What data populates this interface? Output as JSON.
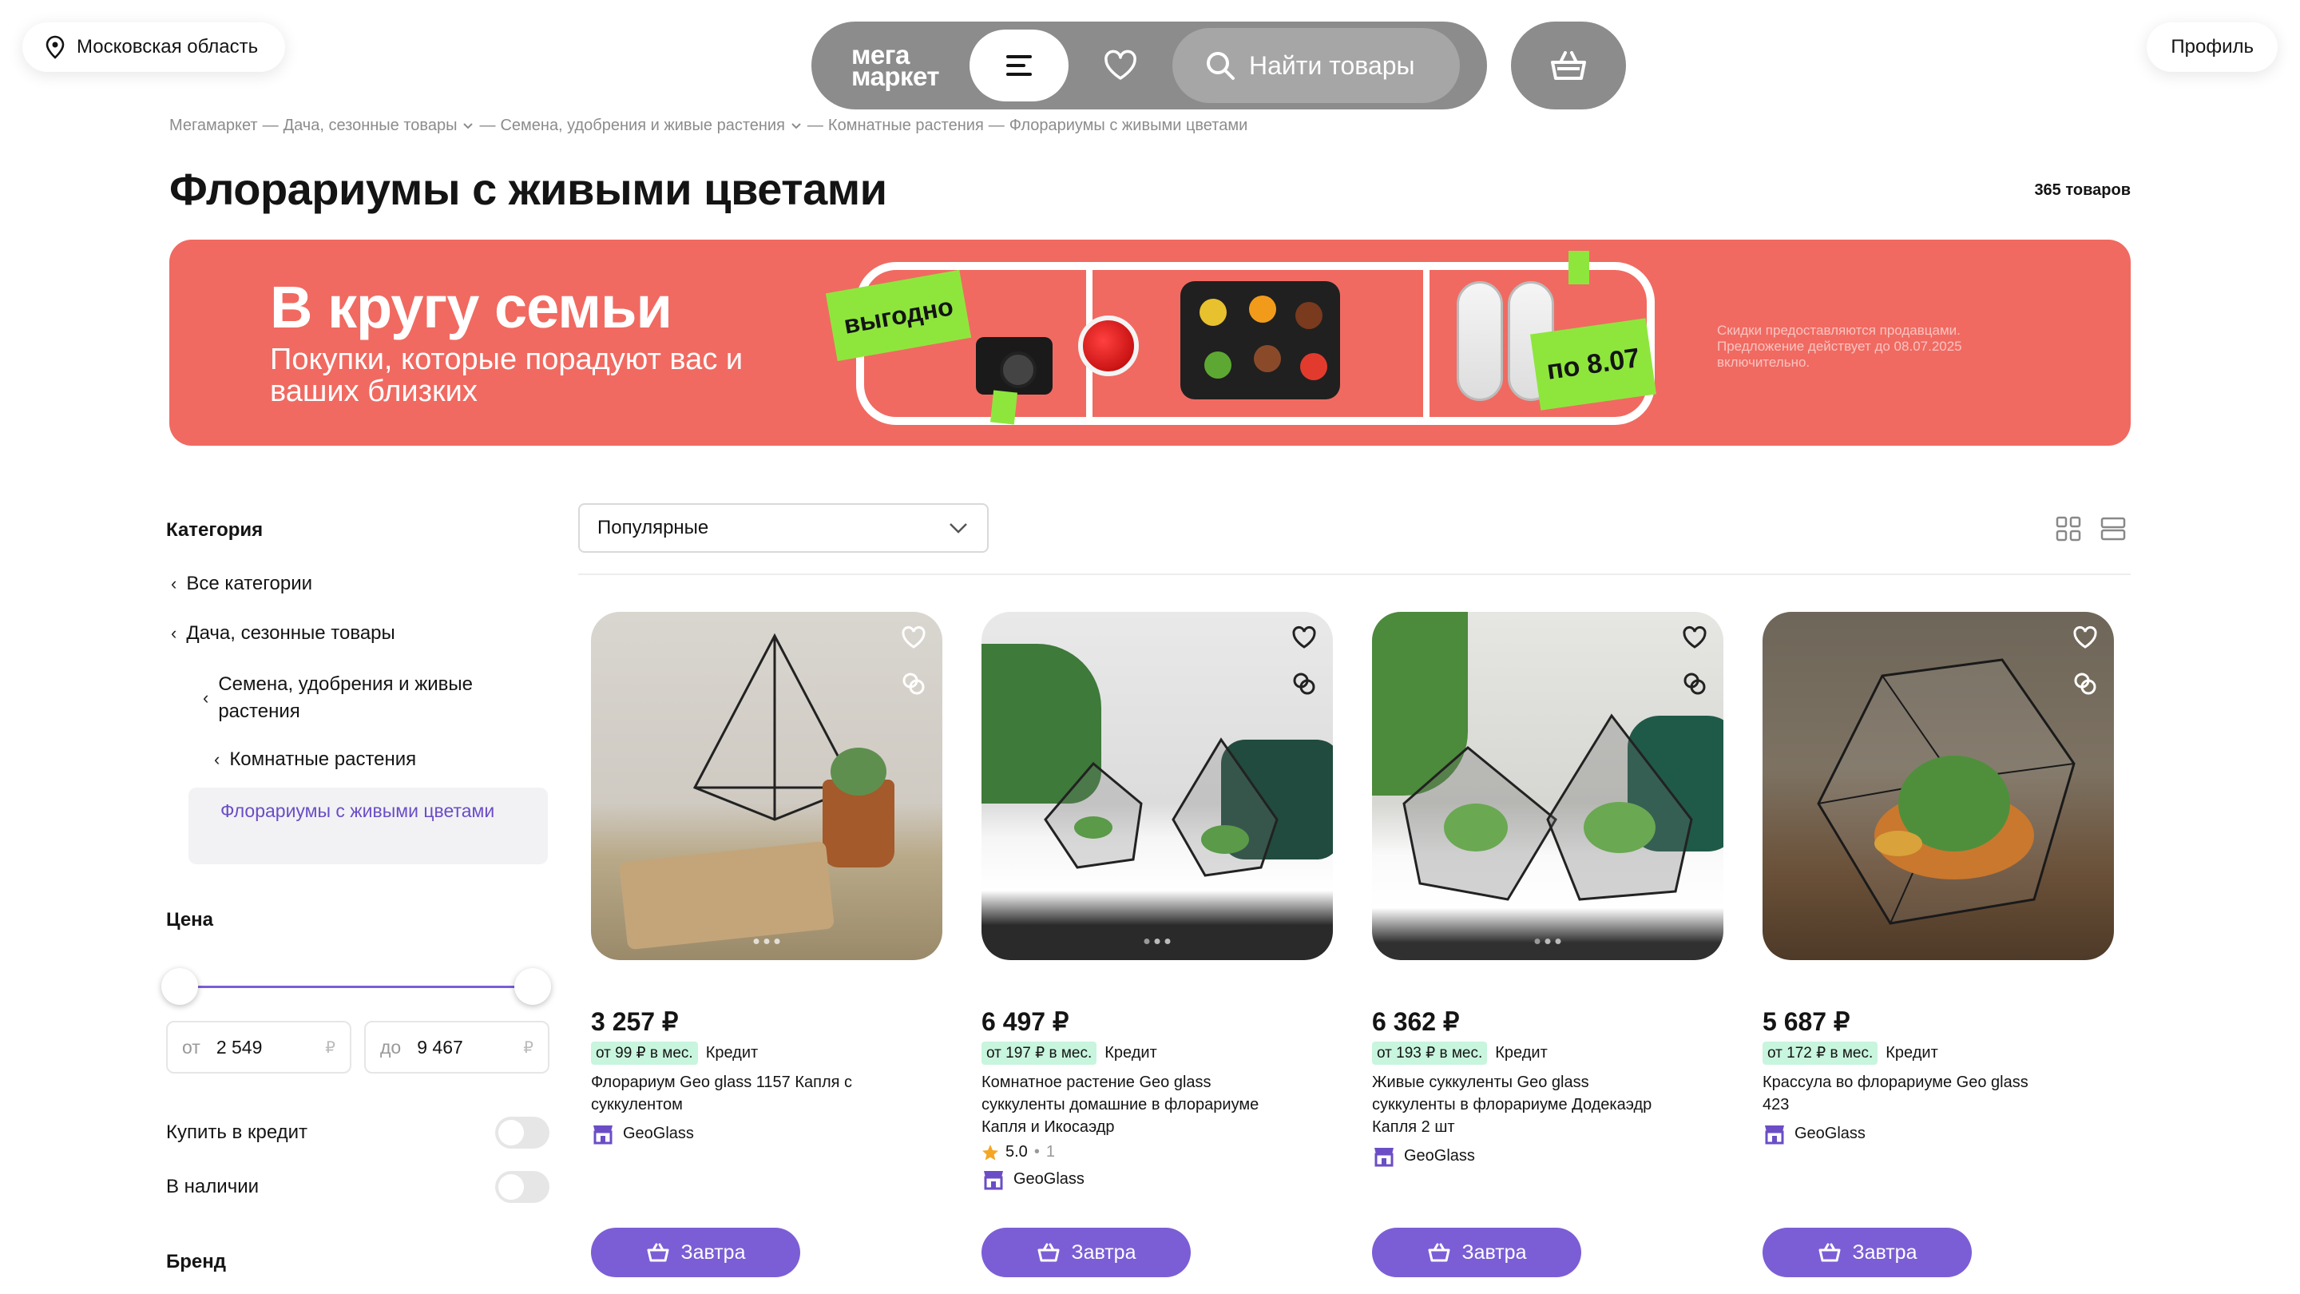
{
  "header": {
    "region": "Московская область",
    "logo_line1": "мега",
    "logo_line2": "маркет",
    "search_label": "Найти товары",
    "profile": "Профиль"
  },
  "breadcrumbs": [
    "Мегамаркет",
    "Дача, сезонные товары",
    "Семена, удобрения и живые растения",
    "Комнатные растения",
    "Флорариумы с живыми цветами"
  ],
  "page": {
    "title": "Флорариумы с живыми цветами",
    "count": "365 товаров"
  },
  "banner": {
    "title": "В кругу семьи",
    "subtitle": "Покупки, которые порадуют вас и ваших близких",
    "sticker1": "выгодно",
    "sticker2": "по 8.07",
    "note": "Скидки предоставляются продавцами. Предложение действует до 08.07.2025 включительно."
  },
  "sidebar": {
    "category_heading": "Категория",
    "categories": [
      "Все категории",
      "Дача, сезонные товары",
      "Семена, удобрения и живые растения",
      "Комнатные растения"
    ],
    "active_category": "Флорариумы с живыми цветами",
    "price_heading": "Цена",
    "price_from_prefix": "от",
    "price_from": "2 549",
    "price_to_prefix": "до",
    "price_to": "9 467",
    "currency": "₽",
    "credit_toggle": "Купить в кредит",
    "stock_toggle": "В наличии",
    "brand_heading": "Бренд"
  },
  "sort": {
    "selected": "Популярные"
  },
  "products": [
    {
      "price": "3 257 ₽",
      "credit": "от 99 ₽ в мес.",
      "credit_label": "Кредит",
      "title": "Флорариум Geo glass 1157 Капля с суккулентом",
      "seller": "GeoGlass",
      "button": "Завтра"
    },
    {
      "price": "6 497 ₽",
      "credit": "от 197 ₽ в мес.",
      "credit_label": "Кредит",
      "title": "Комнатное растение Geo glass суккуленты домашние в флорариуме Капля и Икосаэдр",
      "rating": "5.0",
      "rating_count": "1",
      "seller": "GeoGlass",
      "button": "Завтра"
    },
    {
      "price": "6 362 ₽",
      "credit": "от 193 ₽ в мес.",
      "credit_label": "Кредит",
      "title": "Живые суккуленты Geo glass суккуленты в флорариуме Додекаэдр Капля 2 шт",
      "seller": "GeoGlass",
      "button": "Завтра"
    },
    {
      "price": "5 687 ₽",
      "credit": "от 172 ₽ в мес.",
      "credit_label": "Кредит",
      "title": "Крассула во флорариуме Geo glass 423",
      "seller": "GeoGlass",
      "button": "Завтра"
    }
  ],
  "colors": {
    "accent": "#7b5ed6",
    "banner": "#f06a61",
    "sticker": "#8ee63d",
    "credit_badge": "#c8f5dd",
    "nav": "#8c8c8c"
  }
}
